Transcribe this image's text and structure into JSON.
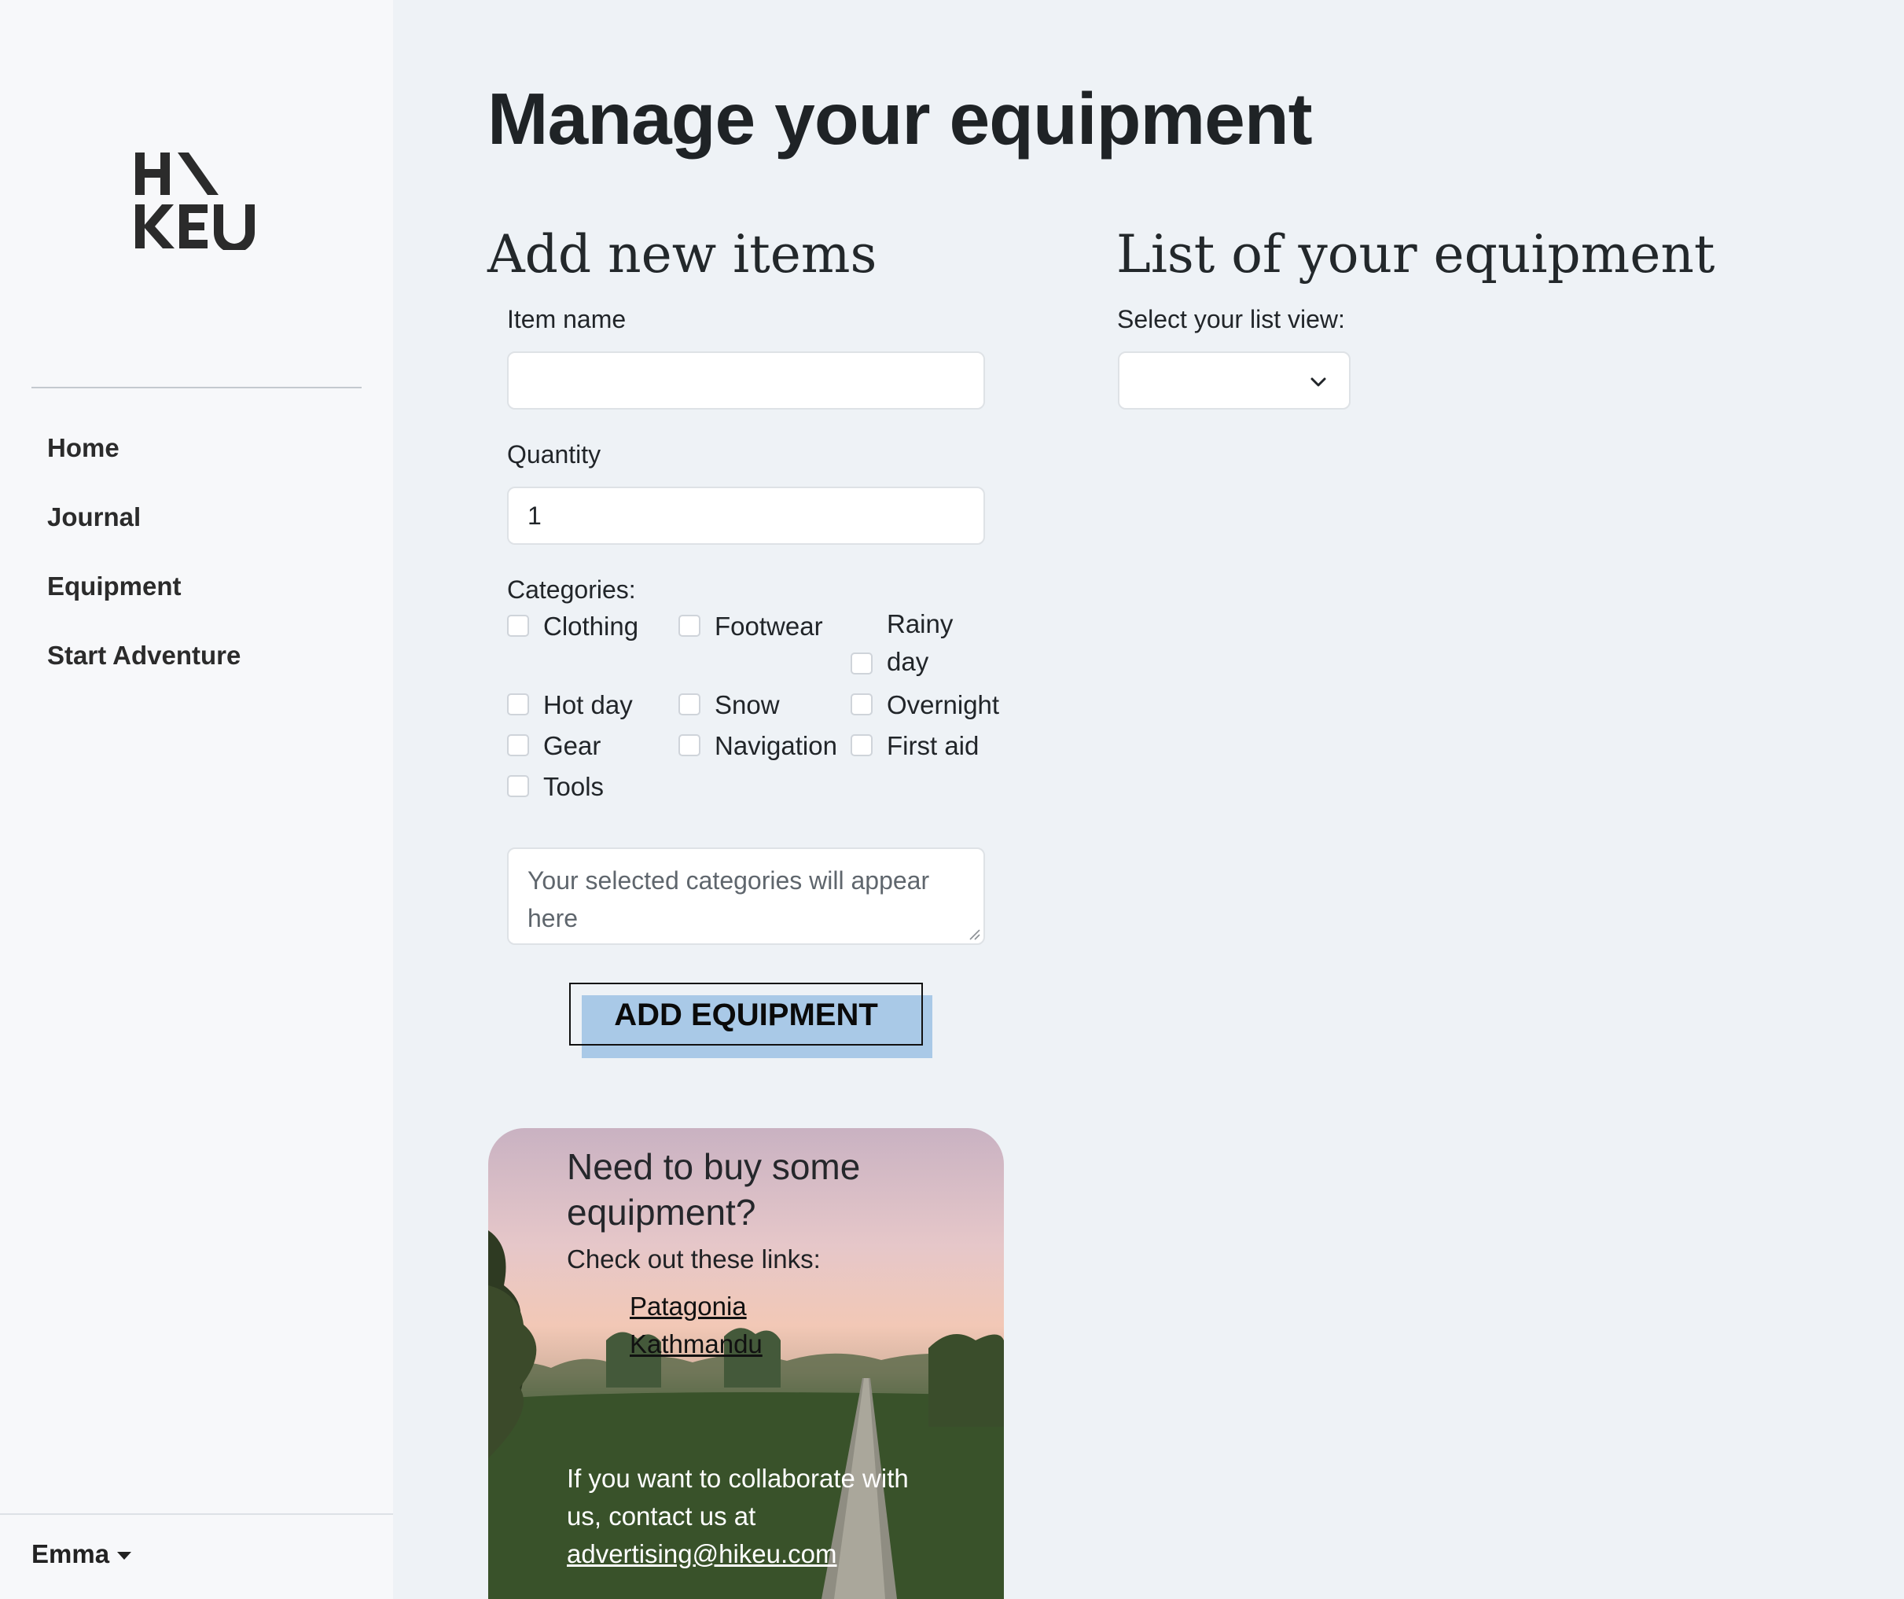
{
  "brand": {
    "logo_text": "HIKEU"
  },
  "sidebar": {
    "nav": [
      {
        "label": "Home"
      },
      {
        "label": "Journal"
      },
      {
        "label": "Equipment"
      },
      {
        "label": "Start Adventure"
      }
    ],
    "user": {
      "name": "Emma"
    }
  },
  "main": {
    "title": "Manage your equipment",
    "add_section": {
      "title": "Add new items",
      "item_name": {
        "label": "Item name",
        "value": ""
      },
      "quantity": {
        "label": "Quantity",
        "value": "1"
      },
      "categories_label": "Categories:",
      "categories": [
        {
          "label": "Clothing",
          "checked": false
        },
        {
          "label": "Footwear",
          "checked": false
        },
        {
          "label": "Rainy day",
          "checked": false
        },
        {
          "label": "Hot day",
          "checked": false
        },
        {
          "label": "Snow",
          "checked": false
        },
        {
          "label": "Overnight",
          "checked": false
        },
        {
          "label": "Gear",
          "checked": false
        },
        {
          "label": "Navigation",
          "checked": false
        },
        {
          "label": "First aid",
          "checked": false
        },
        {
          "label": "Tools",
          "checked": false
        }
      ],
      "selected_placeholder": "Your selected categories will appear here",
      "button_label": "ADD EQUIPMENT"
    },
    "list_section": {
      "title": "List of your equipment",
      "view_label": "Select your list view:",
      "view_value": ""
    }
  },
  "promo": {
    "title": "Need to buy some equipment?",
    "subtitle": "Check out these links:",
    "links": [
      "Patagonia",
      "Kathmandu"
    ],
    "contact_text": "If you want to collaborate with us, contact us at",
    "email": "advertising@hikeu.com"
  },
  "colors": {
    "page_bg": "#eef2f6",
    "sidebar_bg": "#f7f8fa",
    "button_highlight": "#a9c9e7",
    "text": "#212529"
  }
}
